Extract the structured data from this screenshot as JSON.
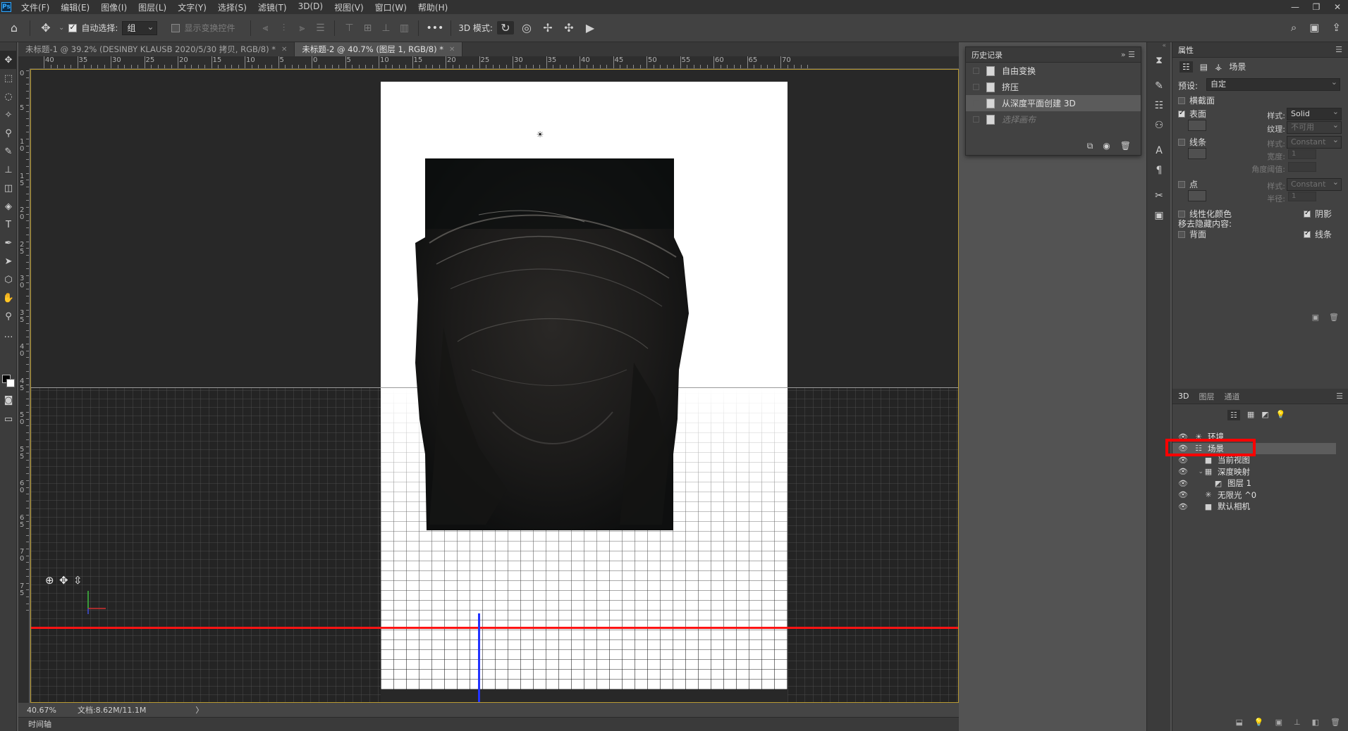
{
  "app": {
    "logo": "Ps",
    "menu": [
      "文件(F)",
      "编辑(E)",
      "图像(I)",
      "图层(L)",
      "文字(Y)",
      "选择(S)",
      "滤镜(T)",
      "3D(D)",
      "视图(V)",
      "窗口(W)",
      "帮助(H)"
    ],
    "window_controls": [
      "minimize-icon",
      "restore-icon",
      "close-icon"
    ]
  },
  "options_bar": {
    "auto_select_label": "自动选择:",
    "auto_select_checked": true,
    "auto_select_value": "组",
    "show_transform_label": "显示变换控件",
    "show_transform_checked": false,
    "more_label": "•••",
    "mode_3d_label": "3D 模式:"
  },
  "tabs": [
    {
      "label": "未标题-1 @ 39.2% (DESINBY KLAUSB    2020/5/30 拷贝, RGB/8) *",
      "active": false
    },
    {
      "label": "未标题-2 @ 40.7% (图层 1, RGB/8) *",
      "active": true
    }
  ],
  "rulers": {
    "horizontal": [
      "40",
      "35",
      "30",
      "25",
      "20",
      "15",
      "10",
      "5",
      "0",
      "5",
      "10",
      "15",
      "20",
      "25",
      "30",
      "35",
      "40",
      "45",
      "50",
      "55",
      "60",
      "65",
      "70"
    ],
    "vertical": [
      "0",
      "5",
      "1\n0",
      "1\n5",
      "2\n0",
      "2\n5",
      "3\n0",
      "3\n5",
      "4\n0",
      "4\n5",
      "5\n0",
      "5\n5",
      "6\n0",
      "6\n5",
      "7\n0",
      "7\n5"
    ]
  },
  "status": {
    "zoom": "40.67%",
    "doc": "文档:8.62M/11.1M",
    "arrow": "〉"
  },
  "timeline_label": "时间轴",
  "history": {
    "title": "历史记录",
    "items": [
      {
        "label": "自由变换",
        "state": "normal"
      },
      {
        "label": "挤压",
        "state": "normal"
      },
      {
        "label": "从深度平面创建 3D",
        "state": "selected"
      },
      {
        "label": "选择画布",
        "state": "dim"
      }
    ]
  },
  "properties": {
    "tab": "属性",
    "scene_label": "场景",
    "preset_label": "预设:",
    "preset_value": "自定",
    "cross_section": "横截面",
    "surface": "表面",
    "surface_checked": true,
    "style_label": "样式:",
    "surface_style": "Solid",
    "texture_label": "纹理:",
    "texture_value": "不可用",
    "lines": "线条",
    "lines_style": "Constant",
    "width_label": "宽度:",
    "width_value": "1",
    "angle_label": "角度阈值:",
    "points": "点",
    "points_style": "Constant",
    "radius_label": "半径:",
    "radius_value": "1",
    "linearize": "线性化颜色",
    "shadow": "阴影",
    "shadow_checked": true,
    "remove_hidden": "移去隐藏内容:",
    "backface": "背面",
    "lines2": "线条",
    "lines2_checked": true
  },
  "layers_panel": {
    "tabs": [
      "3D",
      "图层",
      "通道"
    ],
    "items": [
      {
        "label": "环境",
        "icon": "environment-icon",
        "indent": 0
      },
      {
        "label": "场景",
        "icon": "scene-icon",
        "indent": 0,
        "selected": true
      },
      {
        "label": "当前视图",
        "icon": "camera-icon",
        "indent": 1
      },
      {
        "label": "深度映射",
        "icon": "mesh-icon",
        "indent": 1,
        "expanded": true
      },
      {
        "label": "图层 1",
        "icon": "material-icon",
        "indent": 2
      },
      {
        "label": "无限光 ^0",
        "icon": "light-icon",
        "indent": 1
      },
      {
        "label": "默认相机",
        "icon": "camera-icon",
        "indent": 1
      }
    ]
  },
  "colors": {
    "accent_red": "#ff0000",
    "axis_red": "#ff1414",
    "axis_blue": "#2233ff",
    "canvas_border": "#b89a33"
  }
}
